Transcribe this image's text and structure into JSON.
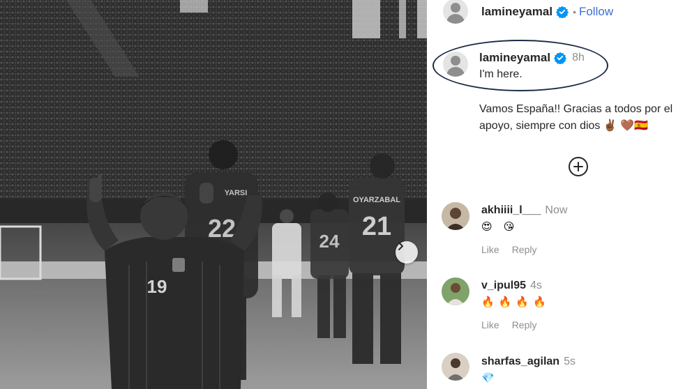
{
  "post": {
    "author": "lamineyamal",
    "follow_label": "Follow",
    "dot": "•",
    "caption": {
      "author": "lamineyamal",
      "time": "8h",
      "line1": "I'm here.",
      "line2": "Vamos España!! Gracias a todos por el apoyo, siempre con dios ✌🏾 🤎🇪🇸"
    },
    "photo": {
      "jersey_numbers": [
        "19",
        "22",
        "21",
        "24"
      ],
      "name_tags": [
        "YARSI",
        "OYARZABAL"
      ]
    }
  },
  "comments": [
    {
      "user": "akhiiii_l___",
      "time": "Now",
      "text": "😍 😘",
      "like_label": "Like",
      "reply_label": "Reply"
    },
    {
      "user": "v_ipul95",
      "time": "4s",
      "text": "🔥🔥🔥🔥",
      "like_label": "Like",
      "reply_label": "Reply"
    },
    {
      "user": "sharfas_agilan",
      "time": "5s",
      "text": "💎"
    }
  ],
  "colors": {
    "verified_blue": "#0095f6",
    "follow_blue": "#3b6fd0",
    "oval_border": "#1a2b45"
  }
}
